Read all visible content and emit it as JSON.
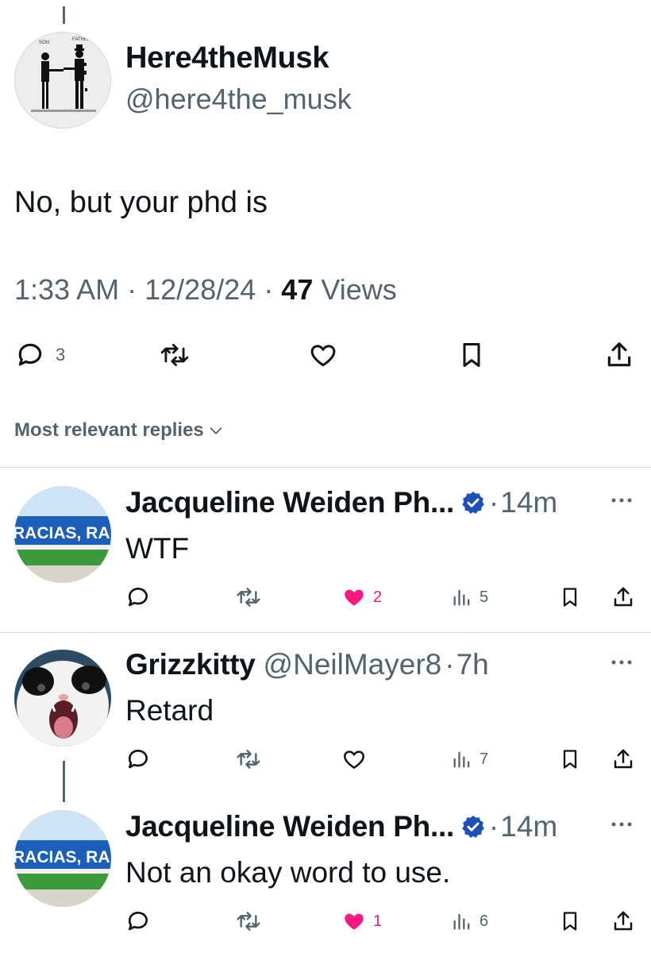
{
  "main_tweet": {
    "avatar_labels": {
      "left": "SON",
      "right": "FATHER"
    },
    "name": "Here4theMusk",
    "handle": "@here4the_musk",
    "text": "No, but your phd is",
    "time": "1:33 AM",
    "date": "12/28/24",
    "separator": "·",
    "views_count": "47",
    "views_label": "Views",
    "reply_count": "3"
  },
  "sort_label": "Most relevant replies",
  "replies": [
    {
      "name": "Jacqueline Weiden Ph...",
      "verified": true,
      "time": "14m",
      "text": "WTF",
      "like_count": "2",
      "liked": true,
      "views": "5",
      "avatar_text": "RACIAS, RAFA"
    },
    {
      "name": "Grizzkitty",
      "handle": "@NeilMayer8",
      "time": "7h",
      "text": "Retard",
      "views": "7"
    },
    {
      "name": "Jacqueline Weiden Ph...",
      "verified": true,
      "time": "14m",
      "text": "Not an okay word to use.",
      "like_count": "1",
      "liked": true,
      "views": "6",
      "avatar_text": "RACIAS, RAFA"
    }
  ],
  "colors": {
    "text": "#0f1419",
    "secondary": "#536471",
    "like": "#f91880",
    "verified": "#1d4fb5",
    "divider": "#dbdfe3"
  },
  "icons": [
    "reply-icon",
    "retweet-icon",
    "like-icon",
    "bookmark-icon",
    "share-icon",
    "views-icon",
    "verified-icon",
    "more-icon",
    "chevron-down-icon"
  ]
}
